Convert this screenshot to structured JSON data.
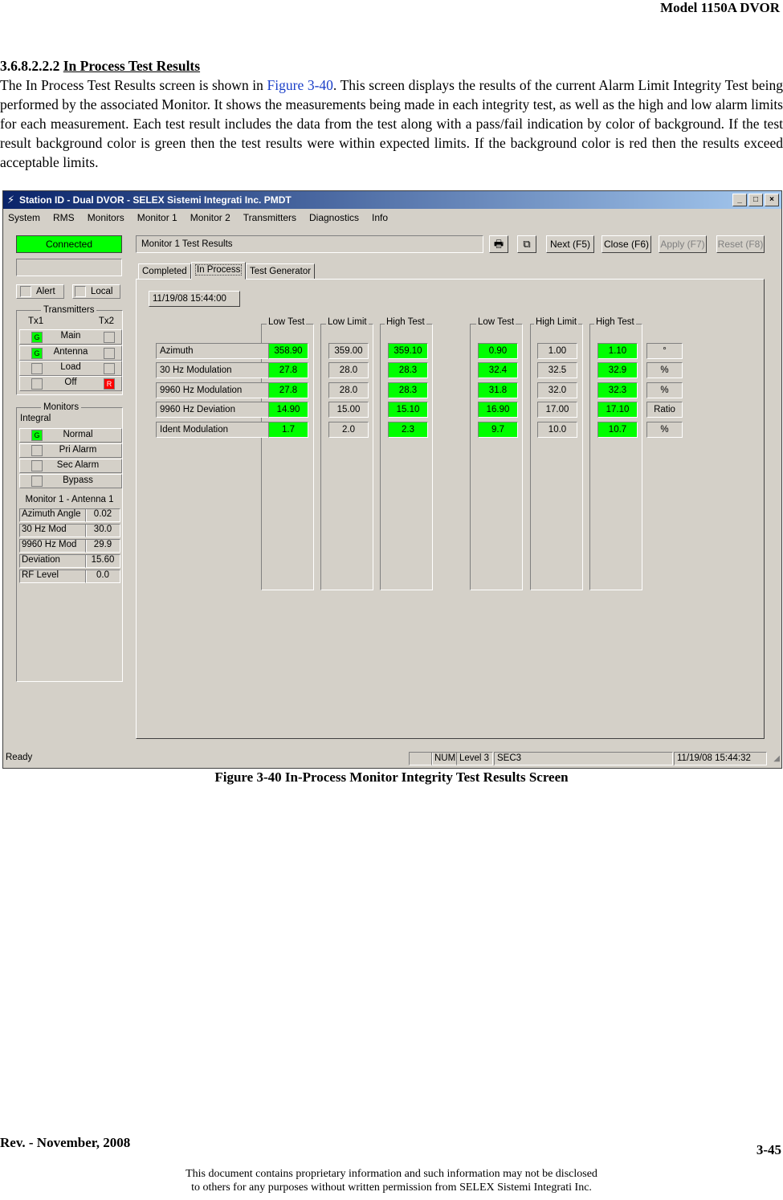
{
  "header": {
    "model": "Model 1150A DVOR"
  },
  "section": {
    "number": "3.6.8.2.2.2",
    "title": "In Process Test Results",
    "body_pre": "The In Process Test Results screen is shown in ",
    "figure_ref": "Figure 3-40",
    "body_post": ". This screen displays the results of the current Alarm Limit Integrity Test being performed by the associated Monitor. It shows the measurements being made in each integrity test, as well as the high and low alarm limits for each measurement.  Each test result includes the data from the test along with a pass/fail indication by color of background.  If the test result background color is green then the test results were within expected limits.  If the background color is red then the results exceed acceptable limits."
  },
  "window": {
    "title": "Station ID - Dual DVOR - SELEX Sistemi Integrati Inc. PMDT",
    "menu": [
      "System",
      "RMS",
      "Monitors",
      "Monitor 1",
      "Monitor 2",
      "Transmitters",
      "Diagnostics",
      "Info"
    ],
    "status_connected": "Connected",
    "alert_label": "Alert",
    "local_label": "Local",
    "transmitters": {
      "legend": "Transmitters",
      "tx1": "Tx1",
      "tx2": "Tx2",
      "rows": [
        {
          "label": "Main",
          "left": "G",
          "right": ""
        },
        {
          "label": "Antenna",
          "left": "G",
          "right": ""
        },
        {
          "label": "Load",
          "left": "",
          "right": ""
        },
        {
          "label": "Off",
          "left": "",
          "right": "R"
        }
      ]
    },
    "monitors": {
      "legend": "Monitors",
      "integral": "Integral",
      "rows": [
        {
          "label": "Normal",
          "ind": "G"
        },
        {
          "label": "Pri Alarm",
          "ind": ""
        },
        {
          "label": "Sec Alarm",
          "ind": ""
        },
        {
          "label": "Bypass",
          "ind": ""
        }
      ],
      "antenna_title": "Monitor 1 - Antenna 1",
      "measurements": [
        {
          "name": "Azimuth Angle",
          "value": "0.02"
        },
        {
          "name": "30 Hz Mod",
          "value": "30.0"
        },
        {
          "name": "9960 Hz Mod",
          "value": "29.9"
        },
        {
          "name": "Deviation",
          "value": "15.60"
        },
        {
          "name": "RF Level",
          "value": "0.0"
        }
      ]
    },
    "main_title": "Monitor 1 Test Results",
    "buttons": {
      "next": "Next (F5)",
      "close": "Close (F6)",
      "apply": "Apply (F7)",
      "reset": "Reset (F8)"
    },
    "tabs": [
      "Completed",
      "In Process",
      "Test Generator"
    ],
    "date": "11/19/08 15:44:00",
    "columns": [
      "Low Test",
      "Low Limit",
      "High Test",
      "Low Test",
      "High Limit",
      "High Test"
    ],
    "rows": [
      {
        "label": "Azimuth",
        "values": [
          "358.90",
          "359.00",
          "359.10",
          "0.90",
          "1.00",
          "1.10"
        ],
        "unit": "°"
      },
      {
        "label": "30 Hz Modulation",
        "values": [
          "27.8",
          "28.0",
          "28.3",
          "32.4",
          "32.5",
          "32.9"
        ],
        "unit": "%"
      },
      {
        "label": "9960 Hz Modulation",
        "values": [
          "27.8",
          "28.0",
          "28.3",
          "31.8",
          "32.0",
          "32.3"
        ],
        "unit": "%"
      },
      {
        "label": "9960 Hz Deviation",
        "values": [
          "14.90",
          "15.00",
          "15.10",
          "16.90",
          "17.00",
          "17.10"
        ],
        "unit": "Ratio"
      },
      {
        "label": "Ident Modulation",
        "values": [
          "1.7",
          "2.0",
          "2.3",
          "9.7",
          "10.0",
          "10.7"
        ],
        "unit": "%"
      }
    ],
    "colors": {
      "pass": "#00ff00",
      "fail": "#ff0000",
      "titlebar": "#0a246a",
      "face": "#d4d0c8"
    },
    "statusbar": {
      "ready": "Ready",
      "num": "NUM",
      "level": "Level 3",
      "sec": "SEC3",
      "time": "11/19/08 15:44:32"
    },
    "icons": {
      "print": "printer-icon",
      "copy": "copy-icon"
    }
  },
  "caption": "Figure 3-40  In-Process Monitor Integrity Test Results Screen",
  "footer": {
    "rev": "Rev. -  November, 2008",
    "page": "3-45",
    "note_line1": "This document contains proprietary information and such information may not be disclosed",
    "note_line2": "to others for any purposes without written permission from SELEX Sistemi Integrati Inc."
  }
}
